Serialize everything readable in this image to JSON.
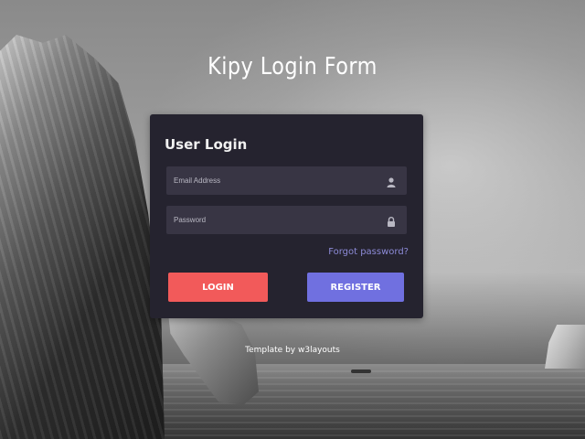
{
  "page": {
    "title": "Kipy Login Form"
  },
  "login": {
    "heading": "User Login",
    "email": {
      "placeholder": "Email Address",
      "value": "",
      "icon": "user-icon"
    },
    "password": {
      "placeholder": "Password",
      "value": "",
      "icon": "lock-icon"
    },
    "forgot_label": "Forgot password?",
    "login_label": "LOGIN",
    "register_label": "REGISTER"
  },
  "footer": {
    "credit": "Template by w3layouts"
  },
  "colors": {
    "card": "#25232f",
    "field": "#383544",
    "login_button": "#f25a5a",
    "register_button": "#7070e0",
    "link": "#8d8bd8"
  }
}
